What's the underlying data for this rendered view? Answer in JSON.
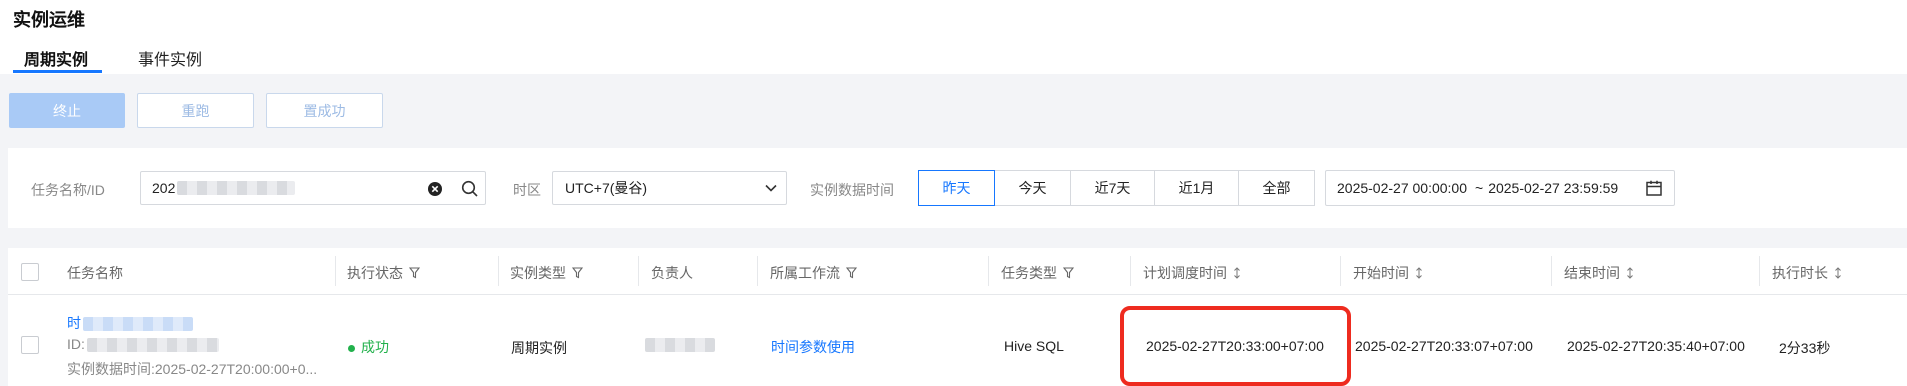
{
  "page": {
    "title": "实例运维"
  },
  "tabs": [
    {
      "label": "周期实例",
      "active": true
    },
    {
      "label": "事件实例",
      "active": false
    }
  ],
  "toolbar": {
    "stop_label": "终止",
    "rerun_label": "重跑",
    "set_success_label": "置成功"
  },
  "filters": {
    "task_label": "任务名称/ID",
    "task_value": "202",
    "timezone_label": "时区",
    "timezone_value": "UTC+7(曼谷)",
    "data_time_label": "实例数据时间",
    "ranges": [
      "昨天",
      "今天",
      "近7天",
      "近1月",
      "全部"
    ],
    "active_range": "昨天",
    "range_start": "2025-02-27 00:00:00",
    "range_sep": "~",
    "range_end": "2025-02-27 23:59:59"
  },
  "table": {
    "columns": [
      "任务名称",
      "执行状态",
      "实例类型",
      "负责人",
      "所属工作流",
      "任务类型",
      "计划调度时间",
      "开始时间",
      "结束时间",
      "执行时长"
    ],
    "rows": [
      {
        "name_prefix": "时",
        "id_prefix": "ID:",
        "data_time": "实例数据时间:2025-02-27T20:00:00+0...",
        "status": "成功",
        "instance_type": "周期实例",
        "workflow": "时间参数使用",
        "task_type": "Hive SQL",
        "scheduled_time": "2025-02-27T20:33:00+07:00",
        "start_time": "2025-02-27T20:33:07+07:00",
        "end_time": "2025-02-27T20:35:40+07:00",
        "duration": "2分33秒"
      }
    ]
  },
  "colors": {
    "accent": "#1677ff",
    "success": "#22b14c",
    "highlight": "#ee2b1f"
  },
  "icons": [
    "clear-icon",
    "search-icon",
    "chevron-down-icon",
    "calendar-icon",
    "filter-icon",
    "sort-icon"
  ]
}
